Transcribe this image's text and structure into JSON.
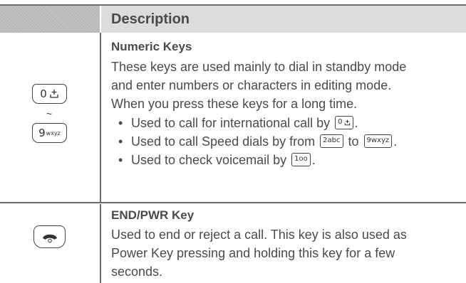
{
  "header": {
    "title": "Description"
  },
  "rows": [
    {
      "keys": {
        "first": "0",
        "last": "9",
        "last_letters": "wxyz",
        "range_mark": "~"
      },
      "heading": "Numeric Keys",
      "lines": [
        "These keys are used mainly to dial in standby mode",
        "and enter numbers or characters in editing mode.",
        "When you press these keys for a long time."
      ],
      "bullets": [
        {
          "before": "Used to call for international call by",
          "key1": "0",
          "after": "."
        },
        {
          "before": "Used to call Speed dials by from",
          "key1": "2abc",
          "middle": "to",
          "key2": "9wxyz",
          "after": "."
        },
        {
          "before": "Used to check voicemail by",
          "key1": "1oo",
          "after": "."
        }
      ]
    },
    {
      "key_icon": "end-call-icon",
      "heading": "END/PWR Key",
      "lines": [
        "Used to end or reject a call. This key is also used as",
        "Power Key pressing and holding this key for a few",
        "seconds."
      ]
    }
  ]
}
